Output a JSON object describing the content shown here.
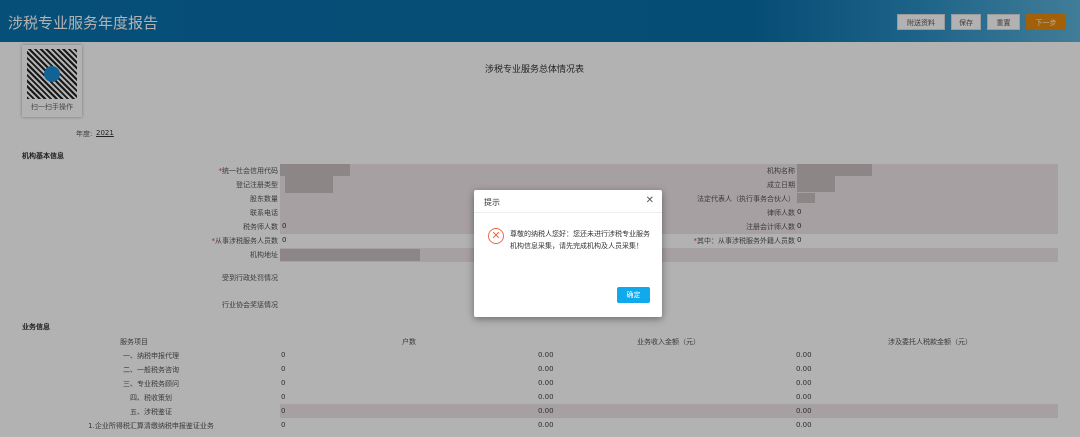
{
  "header": {
    "title": "涉税专业服务年度报告",
    "buttons": [
      "附送资料",
      "保存",
      "重置",
      "下一步"
    ]
  },
  "qr": {
    "caption": "扫一扫手操作"
  },
  "page_title": "涉税专业服务总体情况表",
  "year": {
    "label": "年度:",
    "value": "2021"
  },
  "basic": {
    "title": "机构基本信息",
    "left": [
      {
        "label": "统一社会信用代码",
        "required": true,
        "value": ""
      },
      {
        "label": "登记注册类型",
        "value": ""
      },
      {
        "label": "股东数量",
        "value": ""
      },
      {
        "label": "联系电话",
        "value": ""
      },
      {
        "label": "税务师人数",
        "value": "0"
      },
      {
        "label": "从事涉税服务人员数",
        "required": true,
        "value": "0"
      },
      {
        "label": "机构地址",
        "value": ""
      }
    ],
    "right": [
      {
        "label": "机构名称",
        "value": ""
      },
      {
        "label": "成立日期",
        "value": ""
      },
      {
        "label": "法定代表人（执行事务合伙人）",
        "value": ""
      },
      {
        "label": "律师人数",
        "value": "0"
      },
      {
        "label": "注册会计师人数",
        "value": "0"
      },
      {
        "label": "其中：从事涉税服务外籍人员数",
        "required": true,
        "value": "0"
      }
    ],
    "penalty_label": "受到行政处罚情况",
    "association_label": "行业协会奖惩情况"
  },
  "business": {
    "title": "业务信息",
    "headers": [
      "服务项目",
      "户数",
      "业务收入金额（元）",
      "涉及委托人税款金额（元）"
    ],
    "rows": [
      [
        "一、纳税申报代理",
        "0",
        "0.00",
        "0.00"
      ],
      [
        "二、一般税务咨询",
        "0",
        "0.00",
        "0.00"
      ],
      [
        "三、专业税务顾问",
        "0",
        "0.00",
        "0.00"
      ],
      [
        "四、税收策划",
        "0",
        "0.00",
        "0.00"
      ],
      [
        "五、涉税鉴证",
        "0",
        "0.00",
        "0.00"
      ],
      [
        "1.企业所得税汇算清缴纳税申报鉴证业务",
        "0",
        "0.00",
        "0.00"
      ]
    ]
  },
  "dialog": {
    "title": "提示",
    "message": "尊敬的纳税人您好：您还未进行涉税专业服务机构信息采集，请先完成机构及人员采集！",
    "ok": "确定"
  }
}
